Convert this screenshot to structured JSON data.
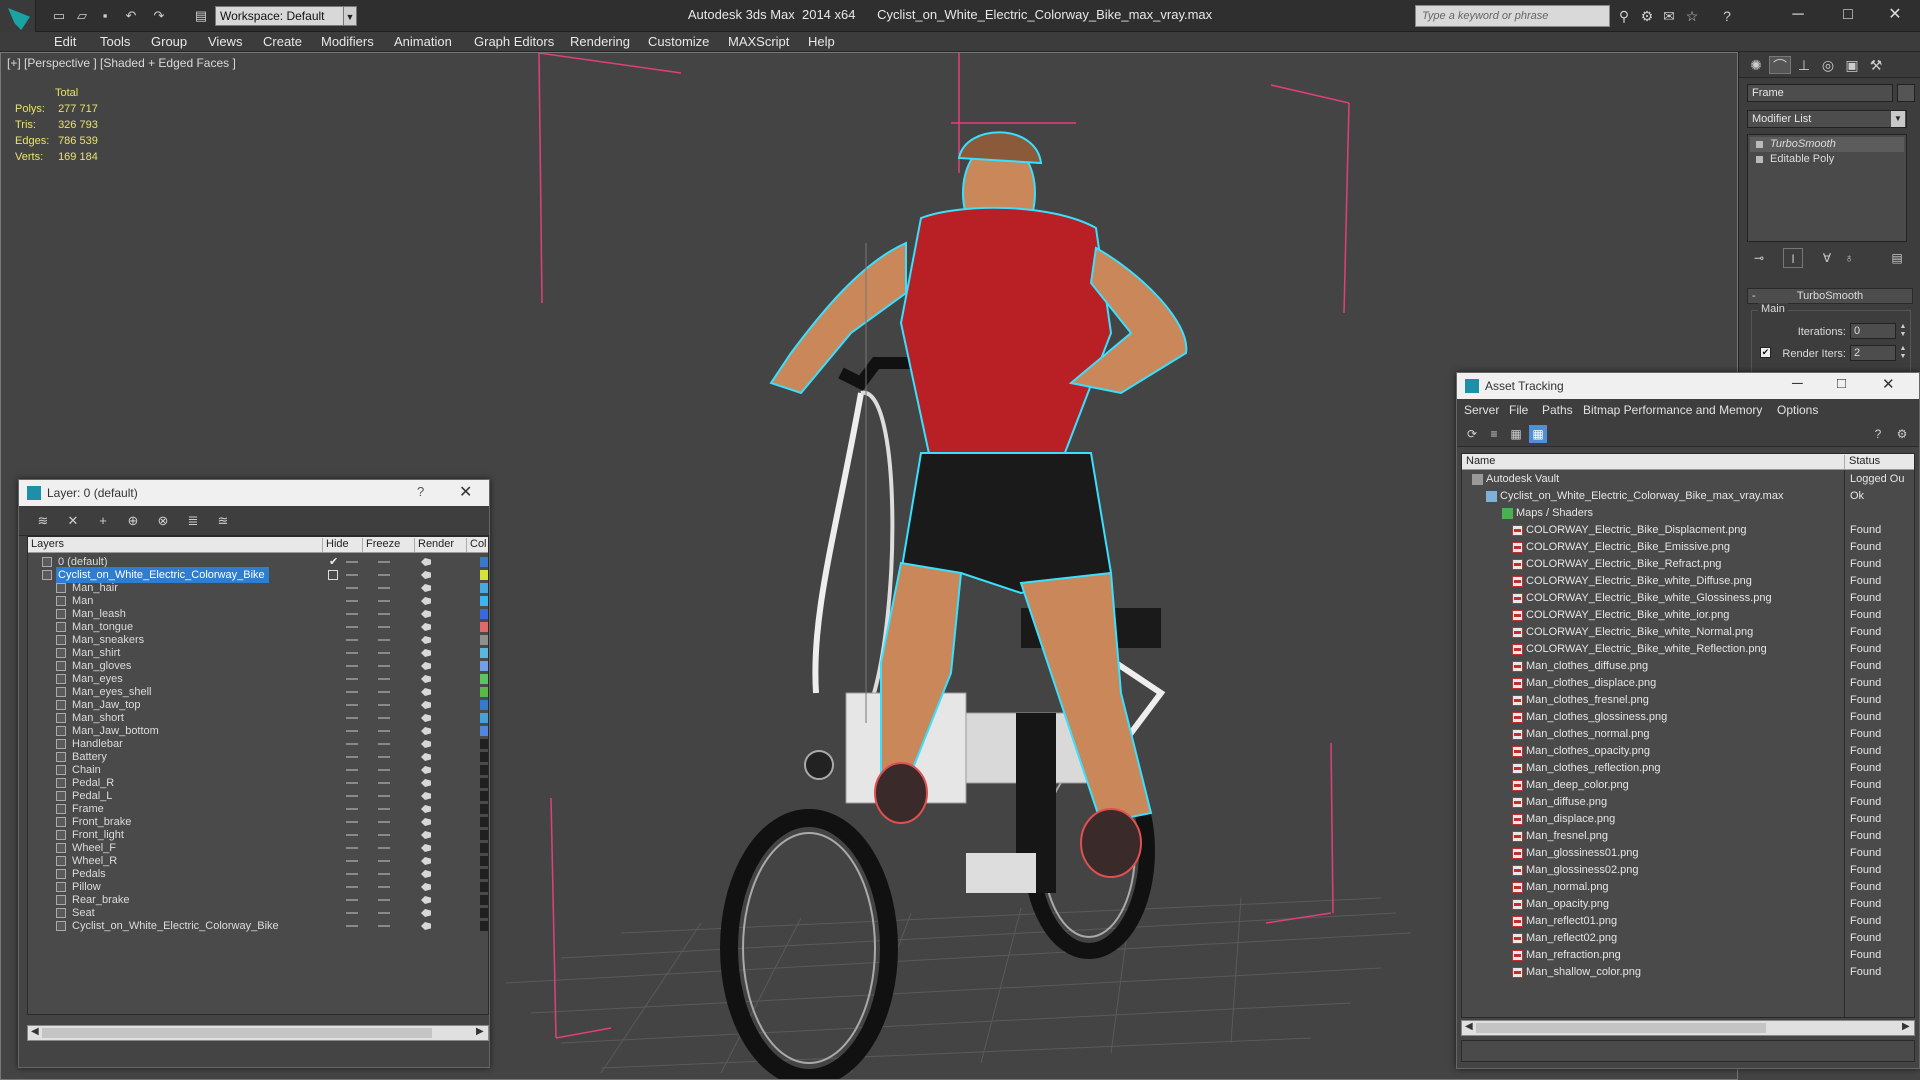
{
  "window": {
    "title": "Autodesk 3ds Max  2014 x64      Cyclist_on_White_Electric_Colorway_Bike_max_vray.max",
    "workspace": "Workspace: Default",
    "search_placeholder": "Type a keyword or phrase"
  },
  "menu": [
    "Edit",
    "Tools",
    "Group",
    "Views",
    "Create",
    "Modifiers",
    "Animation",
    "Graph Editors",
    "Rendering",
    "Customize",
    "MAXScript",
    "Help"
  ],
  "viewport": {
    "label": "[+] [Perspective ] [Shaded + Edged Faces ]",
    "stats_header": "Total",
    "stats": [
      {
        "label": "Polys:",
        "value": "277 717"
      },
      {
        "label": "Tris:",
        "value": "326 793"
      },
      {
        "label": "Edges:",
        "value": "786 539"
      },
      {
        "label": "Verts:",
        "value": "169 184"
      }
    ]
  },
  "command_panel": {
    "object_name": "Frame",
    "modifier_list": "Modifier List",
    "stack": [
      "TurboSmooth",
      "Editable Poly"
    ],
    "rollout_title": "TurboSmooth",
    "group_label": "Main",
    "iterations_label": "Iterations:",
    "iterations_value": "0",
    "render_iters_label": "Render Iters:",
    "render_iters_value": "2"
  },
  "layer_dialog": {
    "title": "Layer: 0 (default)",
    "help": "?",
    "columns": [
      "Layers",
      "Hide",
      "Freeze",
      "Render",
      "Col"
    ],
    "rows": [
      {
        "name": "0 (default)",
        "indent": 1,
        "color": "#3a78d0",
        "check": "check"
      },
      {
        "name": "Cyclist_on_White_Electric_Colorway_Bike",
        "indent": 1,
        "color": "#d8e040",
        "selected": true,
        "check": "box"
      },
      {
        "name": "Man_hair",
        "indent": 2,
        "color": "#4aa8e0"
      },
      {
        "name": "Man",
        "indent": 2,
        "color": "#38b8e8"
      },
      {
        "name": "Man_leash",
        "indent": 2,
        "color": "#3a6ad8"
      },
      {
        "name": "Man_tongue",
        "indent": 2,
        "color": "#e06a6a"
      },
      {
        "name": "Man_sneakers",
        "indent": 2,
        "color": "#909090"
      },
      {
        "name": "Man_shirt",
        "indent": 2,
        "color": "#5ab8e0"
      },
      {
        "name": "Man_gloves",
        "indent": 2,
        "color": "#70a0e8"
      },
      {
        "name": "Man_eyes",
        "indent": 2,
        "color": "#58c858"
      },
      {
        "name": "Man_eyes_shell",
        "indent": 2,
        "color": "#58b848"
      },
      {
        "name": "Man_Jaw_top",
        "indent": 2,
        "color": "#3a78d0"
      },
      {
        "name": "Man_short",
        "indent": 2,
        "color": "#48a0d8"
      },
      {
        "name": "Man_Jaw_bottom",
        "indent": 2,
        "color": "#5088e0"
      },
      {
        "name": "Handlebar",
        "indent": 2,
        "color": "#202020"
      },
      {
        "name": "Battery",
        "indent": 2,
        "color": "#202020"
      },
      {
        "name": "Chain",
        "indent": 2,
        "color": "#202020"
      },
      {
        "name": "Pedal_R",
        "indent": 2,
        "color": "#202020"
      },
      {
        "name": "Pedal_L",
        "indent": 2,
        "color": "#202020"
      },
      {
        "name": "Frame",
        "indent": 2,
        "color": "#202020"
      },
      {
        "name": "Front_brake",
        "indent": 2,
        "color": "#202020"
      },
      {
        "name": "Front_light",
        "indent": 2,
        "color": "#202020"
      },
      {
        "name": "Wheel_F",
        "indent": 2,
        "color": "#202020"
      },
      {
        "name": "Wheel_R",
        "indent": 2,
        "color": "#202020"
      },
      {
        "name": "Pedals",
        "indent": 2,
        "color": "#202020"
      },
      {
        "name": "Pillow",
        "indent": 2,
        "color": "#202020"
      },
      {
        "name": "Rear_brake",
        "indent": 2,
        "color": "#202020"
      },
      {
        "name": "Seat",
        "indent": 2,
        "color": "#202020"
      },
      {
        "name": "Cyclist_on_White_Electric_Colorway_Bike",
        "indent": 2,
        "color": "#202020"
      }
    ]
  },
  "asset_dialog": {
    "title": "Asset Tracking",
    "menu": [
      "Server",
      "File",
      "Paths",
      "Bitmap Performance and Memory",
      "Options"
    ],
    "columns": [
      "Name",
      "Status"
    ],
    "rows": [
      {
        "name": "Autodesk Vault",
        "status": "Logged Ou",
        "level": 0,
        "icon": "vault"
      },
      {
        "name": "Cyclist_on_White_Electric_Colorway_Bike_max_vray.max",
        "status": "Ok",
        "level": 1,
        "icon": "max"
      },
      {
        "name": "Maps / Shaders",
        "status": "",
        "level": 2,
        "icon": "maps"
      },
      {
        "name": "COLORWAY_Electric_Bike_Displacment.png",
        "status": "Found",
        "level": 3,
        "icon": "png"
      },
      {
        "name": "COLORWAY_Electric_Bike_Emissive.png",
        "status": "Found",
        "level": 3,
        "icon": "png"
      },
      {
        "name": "COLORWAY_Electric_Bike_Refract.png",
        "status": "Found",
        "level": 3,
        "icon": "png"
      },
      {
        "name": "COLORWAY_Electric_Bike_white_Diffuse.png",
        "status": "Found",
        "level": 3,
        "icon": "png"
      },
      {
        "name": "COLORWAY_Electric_Bike_white_Glossiness.png",
        "status": "Found",
        "level": 3,
        "icon": "png"
      },
      {
        "name": "COLORWAY_Electric_Bike_white_ior.png",
        "status": "Found",
        "level": 3,
        "icon": "png"
      },
      {
        "name": "COLORWAY_Electric_Bike_white_Normal.png",
        "status": "Found",
        "level": 3,
        "icon": "png"
      },
      {
        "name": "COLORWAY_Electric_Bike_white_Reflection.png",
        "status": "Found",
        "level": 3,
        "icon": "png"
      },
      {
        "name": "Man_clothes_diffuse.png",
        "status": "Found",
        "level": 3,
        "icon": "png"
      },
      {
        "name": "Man_clothes_displace.png",
        "status": "Found",
        "level": 3,
        "icon": "png"
      },
      {
        "name": "Man_clothes_fresnel.png",
        "status": "Found",
        "level": 3,
        "icon": "png"
      },
      {
        "name": "Man_clothes_glossiness.png",
        "status": "Found",
        "level": 3,
        "icon": "png"
      },
      {
        "name": "Man_clothes_normal.png",
        "status": "Found",
        "level": 3,
        "icon": "png"
      },
      {
        "name": "Man_clothes_opacity.png",
        "status": "Found",
        "level": 3,
        "icon": "png"
      },
      {
        "name": "Man_clothes_reflection.png",
        "status": "Found",
        "level": 3,
        "icon": "png"
      },
      {
        "name": "Man_deep_color.png",
        "status": "Found",
        "level": 3,
        "icon": "png"
      },
      {
        "name": "Man_diffuse.png",
        "status": "Found",
        "level": 3,
        "icon": "png"
      },
      {
        "name": "Man_displace.png",
        "status": "Found",
        "level": 3,
        "icon": "png"
      },
      {
        "name": "Man_fresnel.png",
        "status": "Found",
        "level": 3,
        "icon": "png"
      },
      {
        "name": "Man_glossiness01.png",
        "status": "Found",
        "level": 3,
        "icon": "png"
      },
      {
        "name": "Man_glossiness02.png",
        "status": "Found",
        "level": 3,
        "icon": "png"
      },
      {
        "name": "Man_normal.png",
        "status": "Found",
        "level": 3,
        "icon": "png"
      },
      {
        "name": "Man_opacity.png",
        "status": "Found",
        "level": 3,
        "icon": "png"
      },
      {
        "name": "Man_reflect01.png",
        "status": "Found",
        "level": 3,
        "icon": "png"
      },
      {
        "name": "Man_reflect02.png",
        "status": "Found",
        "level": 3,
        "icon": "png"
      },
      {
        "name": "Man_refraction.png",
        "status": "Found",
        "level": 3,
        "icon": "png"
      },
      {
        "name": "Man_shallow_color.png",
        "status": "Found",
        "level": 3,
        "icon": "png"
      }
    ]
  },
  "colors": {
    "stats_text": "#e9e36b",
    "selection": "#2f7dd1",
    "bounding_box": "#e0407a",
    "wire_cyan": "#39e0ff"
  }
}
